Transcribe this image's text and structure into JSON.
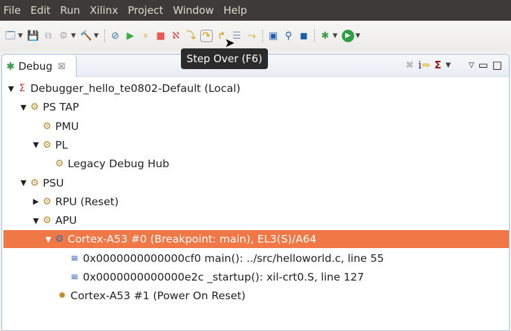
{
  "menu": [
    "File",
    "Edit",
    "Run",
    "Xilinx",
    "Project",
    "Window",
    "Help"
  ],
  "tooltip": "Step Over (F6)",
  "tab": {
    "label": "Debug",
    "close": "☒"
  },
  "tree": [
    {
      "label": "Debugger_hello_te0802-Default (Local)",
      "level": 0,
      "arrow": "▼",
      "icon": "tcf-icon"
    },
    {
      "label": "PS TAP",
      "level": 1,
      "arrow": "▼",
      "icon": "target-icon"
    },
    {
      "label": "PMU",
      "level": 2,
      "arrow": "",
      "icon": "target-icon"
    },
    {
      "label": "PL",
      "level": 2,
      "arrow": "▼",
      "icon": "target-icon"
    },
    {
      "label": "Legacy Debug Hub",
      "level": 3,
      "arrow": "",
      "icon": "target-icon"
    },
    {
      "label": "PSU",
      "level": 1,
      "arrow": "▼",
      "icon": "target-icon"
    },
    {
      "label": "RPU (Reset)",
      "level": 2,
      "arrow": "▶",
      "icon": "target-icon"
    },
    {
      "label": "APU",
      "level": 2,
      "arrow": "▼",
      "icon": "target-icon"
    },
    {
      "label": "Cortex-A53 #0 (Breakpoint: main), EL3(S)/A64",
      "level": 3,
      "arrow": "▼",
      "icon": "thread-suspended-icon",
      "selected": true
    },
    {
      "label": "0x0000000000000cf0 main(): ../src/helloworld.c, line 55",
      "level": 5,
      "arrow": "",
      "icon": "stack-frame-icon"
    },
    {
      "label": "0x0000000000000e2c _startup(): xil-crt0.S, line 127",
      "level": 5,
      "arrow": "",
      "icon": "stack-frame-icon"
    },
    {
      "label": "Cortex-A53 #1 (Power On Reset)",
      "level": 4,
      "arrow": "",
      "icon": "thread-icon"
    }
  ]
}
